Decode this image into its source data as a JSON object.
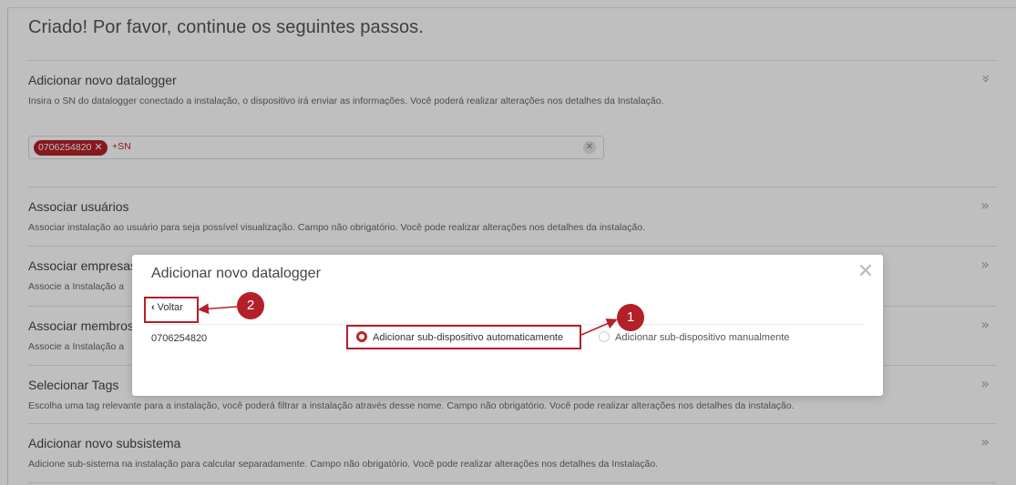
{
  "page": {
    "title": "Criado! Por favor, continue os seguintes passos."
  },
  "steps": [
    {
      "title": "Adicionar novo datalogger",
      "desc": "Insira o SN do datalogger conectado a instalação, o dispositivo irá enviar as informações. Você poderá realizar alterações nos detalhes da Instalação.",
      "chevron": "«"
    },
    {
      "title": "Associar usuários",
      "desc": "Associar instalação ao usuário para seja possível visualização. Campo não obrigatório. Você pode realizar alterações nos detalhes da instalação.",
      "chevron": "»"
    },
    {
      "title": "Associar empresas",
      "desc": "Associe a Instalação a",
      "chevron": "»"
    },
    {
      "title": "Associar membros",
      "desc": "Associe a Instalação a",
      "chevron": "»"
    },
    {
      "title": "Selecionar Tags",
      "desc": "Escolha uma tag relevante para a instalação, você poderá filtrar a instalação através desse nome. Campo não obrigatório. Você pode realizar alterações nos detalhes da instalação.",
      "chevron": "»"
    },
    {
      "title": "Adicionar novo subsistema",
      "desc": "Adicione sub-sistema na instalação para calcular separadamente. Campo não obrigatório. Você pode realizar alterações nos detalhes da Instalação.",
      "chevron": "»"
    }
  ],
  "sn_input": {
    "tag": "0706254820",
    "tag_remove": "✕",
    "add_label": "+SN",
    "clear": "✕"
  },
  "modal": {
    "title": "Adicionar novo datalogger",
    "close": "✕",
    "back_label": "Voltar",
    "back_icon": "‹",
    "sn": "0706254820",
    "options": [
      {
        "label": "Adicionar sub-dispositivo automaticamente",
        "selected": true
      },
      {
        "label": "Adicionar sub-dispositivo manualmente",
        "selected": false
      }
    ]
  },
  "annotations": {
    "badge_1": "1",
    "badge_2": "2",
    "color": "#b3202a"
  }
}
